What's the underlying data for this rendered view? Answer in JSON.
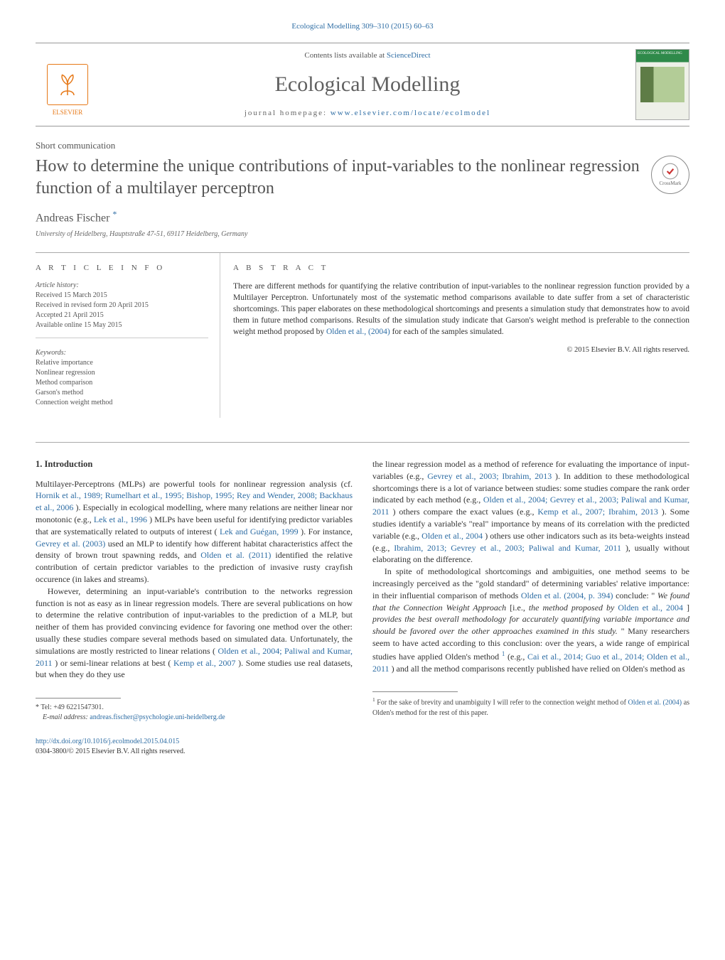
{
  "top_link": {
    "text_prefix": "Ecological Modelling 309–310 (2015) 60–63"
  },
  "header": {
    "contents_line_prefix": "Contents lists available at ",
    "contents_line_link": "ScienceDirect",
    "journal_name": "Ecological Modelling",
    "homepage_prefix": "journal homepage: ",
    "homepage_link": "www.elsevier.com/locate/ecolmodel",
    "elsevier": "ELSEVIER",
    "cover_title": "ECOLOGICAL MODELLING"
  },
  "article": {
    "type": "Short communication",
    "title": "How to determine the unique contributions of input-variables to the nonlinear regression function of a multilayer perceptron",
    "author": "Andreas Fischer",
    "author_mark": "*",
    "affiliation": "University of Heidelberg, Hauptstraße 47-51, 69117 Heidelberg, Germany",
    "crossmark": "CrossMark"
  },
  "info": {
    "heading": "a r t i c l e   i n f o",
    "history_head": "Article history:",
    "history": [
      "Received 15 March 2015",
      "Received in revised form 20 April 2015",
      "Accepted 21 April 2015",
      "Available online 15 May 2015"
    ],
    "keywords_head": "Keywords:",
    "keywords": [
      "Relative importance",
      "Nonlinear regression",
      "Method comparison",
      "Garson's method",
      "Connection weight method"
    ]
  },
  "abstract": {
    "heading": "a b s t r a c t",
    "text_1": "There are different methods for quantifying the relative contribution of input-variables to the nonlinear regression function provided by a Multilayer Perceptron. Unfortunately most of the systematic method comparisons available to date suffer from a set of characteristic shortcomings. This paper elaborates on these methodological shortcomings and presents a simulation study that demonstrates how to avoid them in future method comparisons. Results of the simulation study indicate that Garson's weight method is preferable to the connection weight method proposed by ",
    "ref_1": "Olden et al., (2004)",
    "text_2": " for each of the samples simulated.",
    "copyright": "© 2015 Elsevier B.V. All rights reserved."
  },
  "body": {
    "intro_head": "1.  Introduction",
    "p1_a": "Multilayer-Perceptrons (MLPs) are powerful tools for nonlinear regression analysis (cf. ",
    "p1_ref1": "Hornik et al., 1989; Rumelhart et al., 1995; Bishop, 1995; Rey and Wender, 2008; Backhaus et al., 2006",
    "p1_b": "). Especially in ecological modelling, where many relations are neither linear nor monotonic (e.g., ",
    "p1_ref2": "Lek et al., 1996",
    "p1_c": ") MLPs have been useful for identifying predictor variables that are systematically related to outputs of interest (",
    "p1_ref3": "Lek and Guégan, 1999",
    "p1_d": "). For instance, ",
    "p1_ref4": "Gevrey et al. (2003)",
    "p1_e": " used an MLP to identify how different habitat characteristics affect the density of brown trout spawning redds, and ",
    "p1_ref5": "Olden et al. (2011)",
    "p1_f": " identified the relative contribution of certain predictor variables to the prediction of invasive rusty crayfish occurence (in lakes and streams).",
    "p2_a": "However, determining an input-variable's contribution to the networks regression function is not as easy as in linear regression models. There are several publications on how to determine the relative contribution of input-variables to the prediction of a MLP, but neither of them has provided convincing evidence for favoring one method over the other: usually these studies compare several methods based on simulated data. Unfortunately, the simulations are mostly restricted to linear relations (",
    "p2_ref1": "Olden et al., 2004; Paliwal and Kumar, 2011",
    "p2_b": ") or semi-linear relations at best (",
    "p2_ref2": "Kemp et al., 2007",
    "p2_c": "). Some studies use real datasets, but when they do they use",
    "p3_a": "the linear regression model as a method of reference for evaluating the importance of input-variables (e.g., ",
    "p3_ref1": "Gevrey et al., 2003; Ibrahim, 2013",
    "p3_b": "). In addition to these methodological shortcomings there is a lot of variance between studies: some studies compare the rank order indicated by each method (e.g., ",
    "p3_ref2": "Olden et al., 2004; Gevrey et al., 2003; Paliwal and Kumar, 2011",
    "p3_c": ") others compare the exact values (e.g., ",
    "p3_ref3": "Kemp et al., 2007; Ibrahim, 2013",
    "p3_d": "). Some studies identify a variable's \"real\" importance by means of its correlation with the predicted variable (e.g., ",
    "p3_ref4": "Olden et al., 2004",
    "p3_e": ") others use other indicators such as its beta-weights instead (e.g., ",
    "p3_ref5": "Ibrahim, 2013; Gevrey et al., 2003; Paliwal and Kumar, 2011",
    "p3_f": "), usually without elaborating on the difference.",
    "p4_a": "In spite of methodological shortcomings and ambiguities, one method seems to be increasingly perceived as the \"gold standard\" of determining variables' relative importance: in their influential comparison of methods ",
    "p4_ref1": "Olden et al. (2004, p. 394)",
    "p4_b": " conclude: \"",
    "p4_italic1": "We found that the Connection Weight Approach ",
    "p4_plain1": "[i.e., ",
    "p4_italic1b": "the method proposed by ",
    "p4_ref2": "Olden et al., 2004",
    "p4_plain2": "] ",
    "p4_italic2": "provides the best overall methodology for accurately quantifying variable importance and should be favored over the other approaches examined in this study.",
    "p4_c": "\" Many researchers seem to have acted according to this conclusion: over the years, a wide range of empirical studies have applied Olden's method",
    "p4_sup": "1",
    "p4_d": " (e.g., ",
    "p4_ref3": "Cai et al., 2014; Guo et al., 2014; Olden et al., 2011",
    "p4_e": ") and all the method comparisons recently published have relied on Olden's method as"
  },
  "footnotes": {
    "corr_mark": "*",
    "corr_text": " Tel: +49 6221547301.",
    "email_label": "E-mail address: ",
    "email": "andreas.fischer@psychologie.uni-heidelberg.de",
    "note1_mark": "1",
    "note1_a": " For the sake of brevity and unambiguity I will refer to the connection weight method of ",
    "note1_ref": "Olden et al. (2004)",
    "note1_b": " as Olden's method for the rest of this paper."
  },
  "bottom": {
    "doi": "http://dx.doi.org/10.1016/j.ecolmodel.2015.04.015",
    "issn_copy": "0304-3800/© 2015 Elsevier B.V. All rights reserved."
  }
}
